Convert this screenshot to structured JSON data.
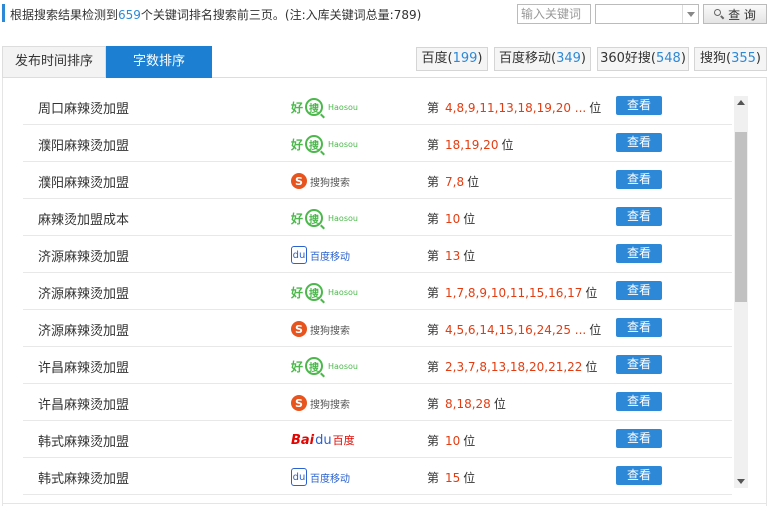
{
  "summary": {
    "prefix": "根据搜索结果检测到",
    "count": "659",
    "suffix": "个关键词排名搜索前三页。(注:入库关键词总量:789)"
  },
  "search": {
    "placeholder": "输入关键词",
    "engine_value": "",
    "query_label": "查 询"
  },
  "sort_tabs": [
    {
      "label": "发布时间排序",
      "active": false
    },
    {
      "label": "字数排序",
      "active": true
    }
  ],
  "engine_tabs": [
    {
      "name": "百度",
      "count": "199"
    },
    {
      "name": "百度移动",
      "count": "349"
    },
    {
      "name": "360好搜",
      "count": "548"
    },
    {
      "name": "搜狗",
      "count": "355"
    }
  ],
  "logos": {
    "haosou": {
      "hao": "好",
      "sou": "搜",
      "name": "Haosou"
    },
    "sogou": {
      "s": "S",
      "name": "搜狗搜索"
    },
    "baidu_mobile": {
      "paw": "du",
      "name": "百度移动"
    },
    "baidu": {
      "bai": "Bai",
      "paw": "du",
      "name": "百度"
    }
  },
  "rank_prefix": "第",
  "rank_suffix": "位",
  "view_label": "查看",
  "rows": [
    {
      "keyword": "周口麻辣烫加盟",
      "engine": "haosou",
      "positions": "4,8,9,11,13,18,19,20 ..."
    },
    {
      "keyword": "濮阳麻辣烫加盟",
      "engine": "haosou",
      "positions": "18,19,20"
    },
    {
      "keyword": "濮阳麻辣烫加盟",
      "engine": "sogou",
      "positions": "7,8"
    },
    {
      "keyword": "麻辣烫加盟成本",
      "engine": "haosou",
      "positions": "10"
    },
    {
      "keyword": "济源麻辣烫加盟",
      "engine": "baidu_mobile",
      "positions": "13"
    },
    {
      "keyword": "济源麻辣烫加盟",
      "engine": "haosou",
      "positions": "1,7,8,9,10,11,15,16,17"
    },
    {
      "keyword": "济源麻辣烫加盟",
      "engine": "sogou",
      "positions": "4,5,6,14,15,16,24,25 ..."
    },
    {
      "keyword": "许昌麻辣烫加盟",
      "engine": "haosou",
      "positions": "2,3,7,8,13,18,20,21,22"
    },
    {
      "keyword": "许昌麻辣烫加盟",
      "engine": "sogou",
      "positions": "8,18,28"
    },
    {
      "keyword": "韩式麻辣烫加盟",
      "engine": "baidu",
      "positions": "10"
    },
    {
      "keyword": "韩式麻辣烫加盟",
      "engine": "baidu_mobile",
      "positions": "15"
    }
  ],
  "colors": {
    "accent_blue": "#1d7fd1",
    "rank_red": "#e23d12",
    "haosou_green": "#4cb84c"
  }
}
